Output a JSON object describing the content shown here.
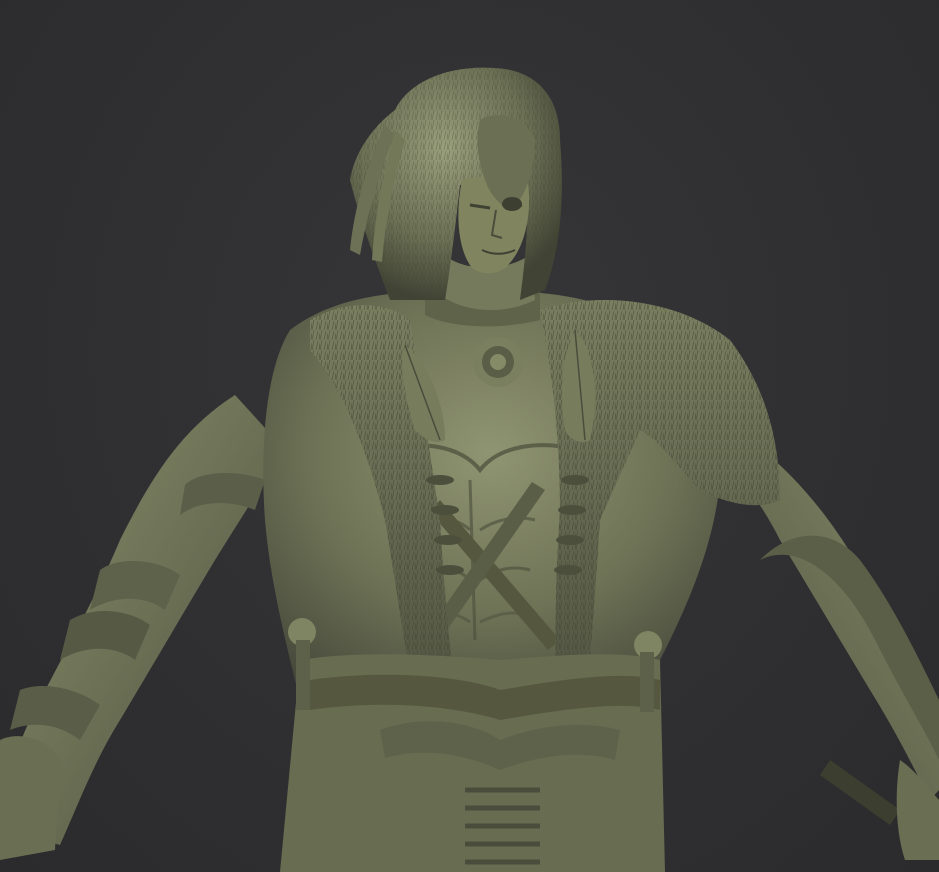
{
  "viewport": {
    "background_color": "#2f2f31",
    "subject": "sculpted-figure",
    "clay_color": "#6f7356",
    "clay_highlight": "#8f9472",
    "clay_shadow": "#3e412f"
  }
}
